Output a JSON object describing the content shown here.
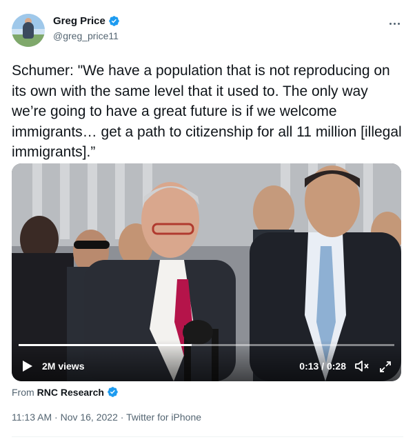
{
  "author": {
    "display_name": "Greg Price",
    "handle": "@greg_price11",
    "avatar_icon": "avatar-photo"
  },
  "tweet": {
    "text": "Schumer: \"We have a population that is not reproducing on its own with the same level that it used to. The only way we’re going to have a great future is if we welcome immigrants… get a path to citizenship for all 11 million [illegal immigrants].”"
  },
  "media": {
    "views": "2M views",
    "time": "0:13 / 0:28",
    "progress_fraction": 0.46,
    "play_icon": "play-icon",
    "mute_icon": "mute-icon",
    "fullscreen_icon": "fullscreen-icon"
  },
  "source": {
    "prefix": "From",
    "name": "RNC Research"
  },
  "meta": {
    "time": "11:13 AM",
    "separator1": " · ",
    "date": "Nov 16, 2022",
    "separator2": " · ",
    "app": "Twitter for iPhone"
  },
  "colors": {
    "verified": "#1d9bf0",
    "secondary_text": "#536471",
    "primary_text": "#0f1419"
  }
}
